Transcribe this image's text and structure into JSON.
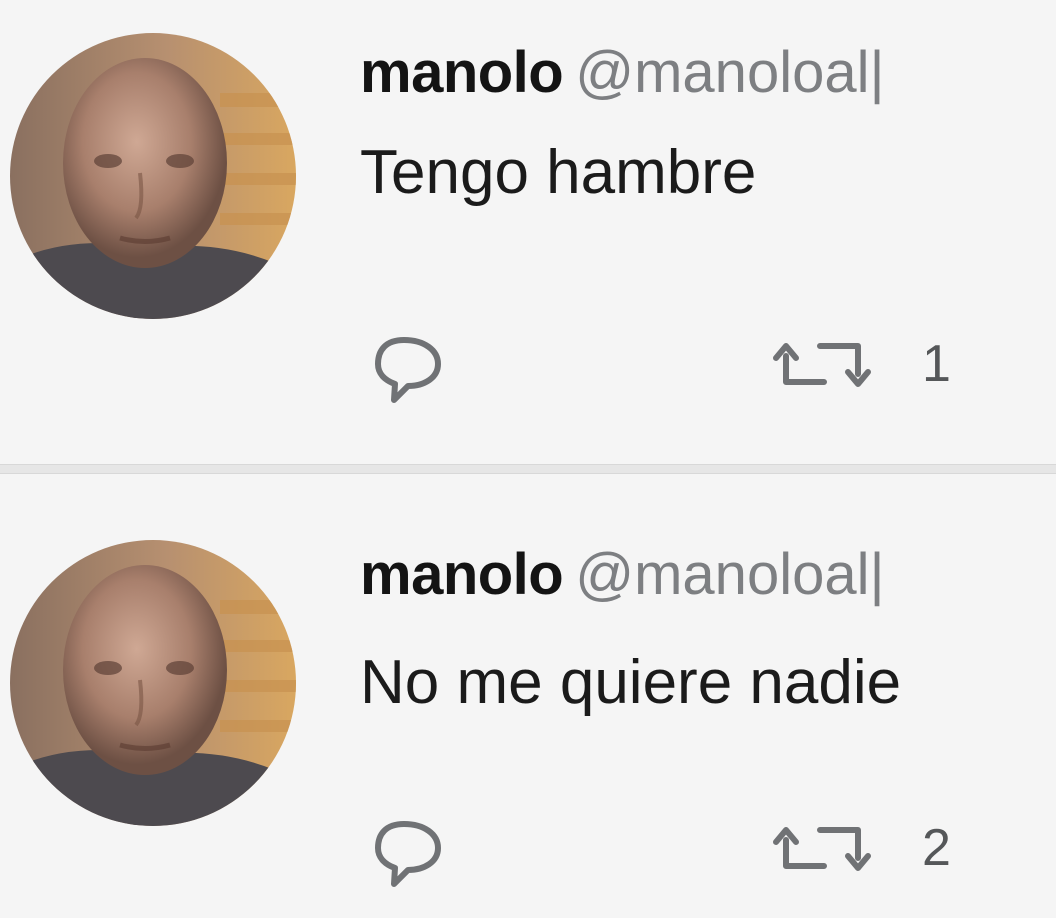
{
  "colors": {
    "background": "#f5f5f5",
    "name_text": "#141414",
    "handle_text": "#7d7f82",
    "body_text": "#1b1b1b",
    "icon": "#707275"
  },
  "tweets": [
    {
      "user": {
        "display_name": "manolo",
        "handle": "@manoloal|"
      },
      "text": "Tengo hambre",
      "actions": {
        "reply_icon": "reply-bubble-icon",
        "retweet_icon": "retweet-icon",
        "retweet_count": "1"
      }
    },
    {
      "user": {
        "display_name": "manolo",
        "handle": "@manoloal|"
      },
      "text": "No me quiere nadie",
      "actions": {
        "reply_icon": "reply-bubble-icon",
        "retweet_icon": "retweet-icon",
        "retweet_count": "2"
      }
    }
  ]
}
